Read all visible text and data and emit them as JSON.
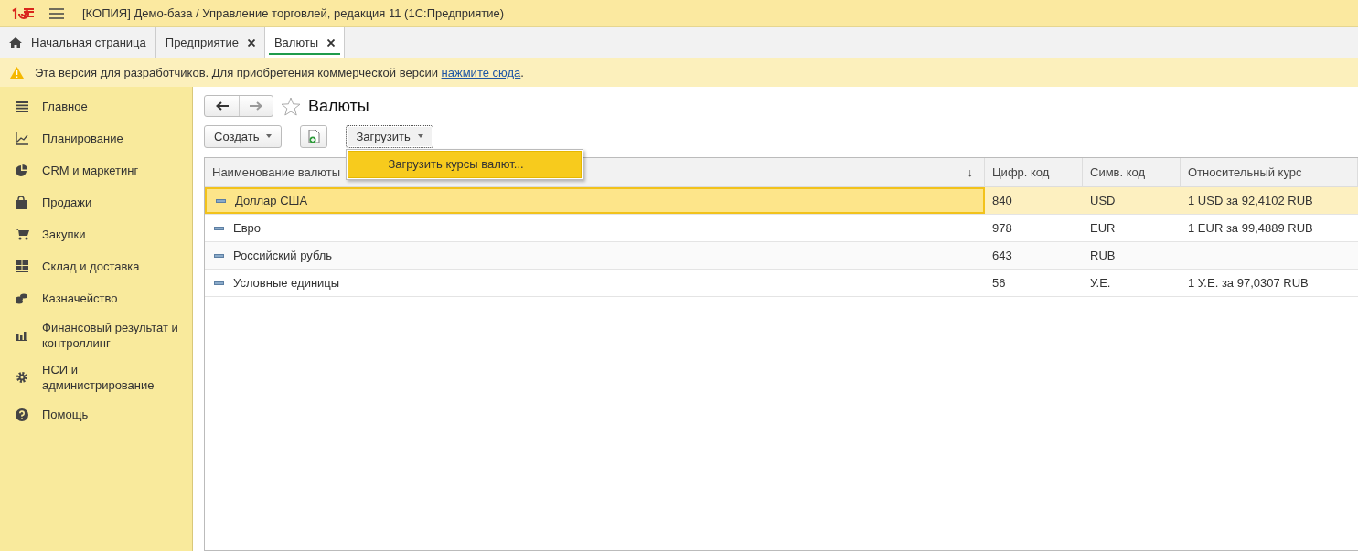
{
  "window": {
    "title": "[КОПИЯ] Демо-база / Управление торговлей, редакция 11  (1С:Предприятие)"
  },
  "tabs": [
    {
      "label": "Начальная страница",
      "selected": false,
      "closable": false
    },
    {
      "label": "Предприятие",
      "selected": false,
      "closable": true
    },
    {
      "label": "Валюты",
      "selected": true,
      "closable": true
    }
  ],
  "notice": {
    "text": "Эта версия для разработчиков. Для приобретения коммерческой версии ",
    "link": "нажмите сюда",
    "tail": "."
  },
  "sidebar": {
    "items": [
      {
        "label": "Главное"
      },
      {
        "label": "Планирование"
      },
      {
        "label": "CRM и маркетинг"
      },
      {
        "label": "Продажи"
      },
      {
        "label": "Закупки"
      },
      {
        "label": "Склад и доставка"
      },
      {
        "label": "Казначейство"
      },
      {
        "label": "Финансовый результат и контроллинг"
      },
      {
        "label": "НСИ и администрирование"
      },
      {
        "label": "Помощь"
      }
    ]
  },
  "page": {
    "title": "Валюты",
    "favorite": false
  },
  "toolbar": {
    "create": "Создать",
    "load": "Загрузить",
    "menu": [
      "Загрузить курсы валют..."
    ]
  },
  "table": {
    "columns": [
      {
        "label": "Наименование валюты",
        "sort": "↓"
      },
      {
        "label": "Цифр. код"
      },
      {
        "label": "Симв. код"
      },
      {
        "label": "Относительный курс"
      }
    ],
    "rows": [
      {
        "name": "Доллар США",
        "code": "840",
        "symbol": "USD",
        "rate": "1 USD за 92,4102 RUB",
        "selected": true
      },
      {
        "name": "Евро",
        "code": "978",
        "symbol": "EUR",
        "rate": "1 EUR за 99,4889 RUB",
        "selected": false
      },
      {
        "name": "Российский рубль",
        "code": "643",
        "symbol": "RUB",
        "selected": false
      },
      {
        "name": "Условные единицы",
        "code": "56",
        "symbol": "У.Е.",
        "rate": "1 У.Е. за 97,0307 RUB",
        "selected": false
      }
    ]
  }
}
